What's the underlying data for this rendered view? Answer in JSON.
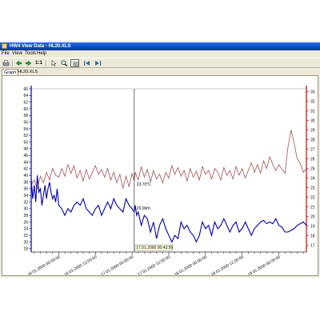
{
  "window": {
    "title": "HW4 View Data - HL20.XLS"
  },
  "menu": [
    "File",
    "View",
    "Tools",
    "Help"
  ],
  "toolbar": {
    "zoom_label": "1:1"
  },
  "tabs": [
    "Graph",
    "HL20.XLS"
  ],
  "colors": {
    "humidity": "#0000aa",
    "temperature": "#a05050",
    "temperature_axis": "#cc0000",
    "cursor": "#303030"
  },
  "chart_data": {
    "type": "line",
    "left_axis": {
      "ticks": [
        18,
        20,
        22,
        24,
        26,
        28,
        30,
        32,
        34,
        36,
        38,
        40,
        42,
        44,
        46,
        48,
        50,
        52,
        54,
        56,
        58,
        60,
        62,
        64,
        66
      ],
      "range": [
        17,
        66
      ]
    },
    "right_axis": {
      "ticks": [
        17,
        18,
        19,
        20,
        21,
        22,
        23,
        24,
        25,
        26,
        27,
        28,
        29,
        30,
        31,
        32,
        33
      ],
      "range": [
        16.3,
        33.3
      ]
    },
    "x_ticks": [
      "16.01.2000 00:00:00",
      "16.01.2000 12:00:00",
      "17.01.2000 00:00:00",
      "17.01.2000 12:00:00",
      "18.01.2000 00:00:00",
      "18.01.2000 12:00:00",
      "19.01.2000 00:00:00"
    ],
    "x_tick_hours": [
      0,
      12,
      24,
      36,
      48,
      60,
      72
    ],
    "x_range": [
      -9,
      81
    ],
    "cursor": {
      "time_label": "17.01.2000 00:43:59",
      "time_hours": 24.7,
      "temperature_label": "23.70°C",
      "humidity_label": "29.00rh"
    },
    "series": [
      {
        "axis": "right",
        "x": [
          -9,
          -8,
          -7,
          -6,
          -5,
          -4,
          -3,
          -2,
          -1,
          0,
          1,
          2,
          3,
          4,
          5,
          6,
          7,
          8,
          9,
          10,
          11,
          12,
          13,
          14,
          15,
          16,
          17,
          18,
          19,
          20,
          21,
          22,
          23,
          24,
          24.7,
          25,
          26,
          27,
          28,
          29,
          30,
          31,
          32,
          33,
          34,
          35,
          36,
          37,
          38,
          39,
          40,
          41,
          42,
          43,
          44,
          45,
          46,
          47,
          48,
          49,
          50,
          51,
          52,
          53,
          54,
          55,
          56,
          57,
          58,
          59,
          60,
          61,
          62,
          63,
          64,
          65,
          66,
          67,
          68,
          69,
          70,
          71,
          72,
          73,
          74,
          75,
          76,
          77,
          78,
          79,
          80,
          81
        ],
        "values": [
          23.3,
          23.8,
          22.9,
          24.2,
          23.5,
          24.6,
          23.8,
          25.0,
          24.3,
          24.1,
          25.0,
          24.2,
          25.4,
          24.5,
          25.3,
          24.0,
          24.8,
          23.7,
          24.9,
          23.9,
          24.6,
          25.3,
          24.4,
          24.9,
          24.1,
          25.0,
          23.8,
          24.6,
          23.5,
          24.4,
          22.9,
          24.2,
          23.1,
          24.5,
          23.7,
          24.6,
          23.8,
          25.2,
          24.1,
          24.9,
          23.6,
          24.8,
          23.9,
          24.4,
          23.5,
          24.6,
          24.0,
          25.3,
          24.4,
          25.1,
          24.2,
          24.8,
          23.7,
          25.0,
          24.1,
          24.7,
          23.8,
          25.2,
          24.4,
          24.8,
          23.9,
          25.0,
          24.6,
          23.8,
          25.1,
          24.3,
          24.8,
          23.9,
          25.2,
          24.3,
          25.0,
          24.0,
          24.8,
          25.6,
          24.6,
          25.4,
          24.5,
          25.8,
          25.0,
          26.2,
          25.4,
          24.8,
          25.4,
          24.9,
          24.5,
          27.3,
          29.0,
          27.6,
          26.0,
          25.5,
          24.6,
          25.0
        ]
      },
      {
        "axis": "left",
        "x": [
          -9,
          -8.5,
          -8,
          -7.5,
          -7,
          -6.5,
          -6,
          -5.5,
          -5,
          -4.5,
          -4,
          -3.5,
          -3,
          -2.5,
          -2,
          -1.5,
          -1,
          -0.5,
          0,
          1,
          2,
          3,
          4,
          5,
          6,
          7,
          8,
          9,
          10,
          11,
          12,
          13,
          14,
          15,
          16,
          17,
          18,
          19,
          20,
          21,
          22,
          23,
          24,
          24.7,
          25,
          25.5,
          26,
          27,
          28,
          29,
          30,
          31,
          32,
          33,
          34,
          35,
          36,
          37,
          38,
          39,
          40,
          41,
          42,
          43,
          44,
          45,
          46,
          47,
          48,
          49,
          50,
          51,
          52,
          53,
          54,
          55,
          56,
          57,
          58,
          59,
          60,
          61,
          62,
          63,
          64,
          65,
          66,
          67,
          68,
          69,
          70,
          71,
          72,
          73,
          74,
          75,
          76,
          77,
          78,
          79,
          80,
          81
        ],
        "values": [
          39,
          33,
          37,
          32,
          40,
          35,
          36,
          31,
          34,
          37,
          33,
          36,
          38,
          35,
          33,
          34,
          32,
          36,
          31,
          30,
          28,
          30,
          29,
          31,
          32,
          31,
          33,
          30,
          29,
          28,
          30,
          31,
          28,
          30,
          32,
          30,
          33,
          31,
          30,
          29,
          33,
          31,
          30,
          29,
          31,
          28,
          29,
          25,
          28,
          27,
          23,
          26,
          21,
          25,
          27,
          24,
          22,
          20,
          22,
          21,
          26,
          24,
          25,
          23,
          22,
          20,
          22,
          26,
          24,
          25,
          22,
          26,
          24,
          25,
          27,
          25,
          23,
          25,
          26,
          23,
          24,
          26,
          24,
          22,
          24,
          25,
          26,
          26.5,
          25.5,
          26,
          25.5,
          27,
          25,
          24.5,
          23,
          23,
          23.5,
          24,
          25,
          25.5,
          26,
          25
        ]
      }
    ]
  }
}
